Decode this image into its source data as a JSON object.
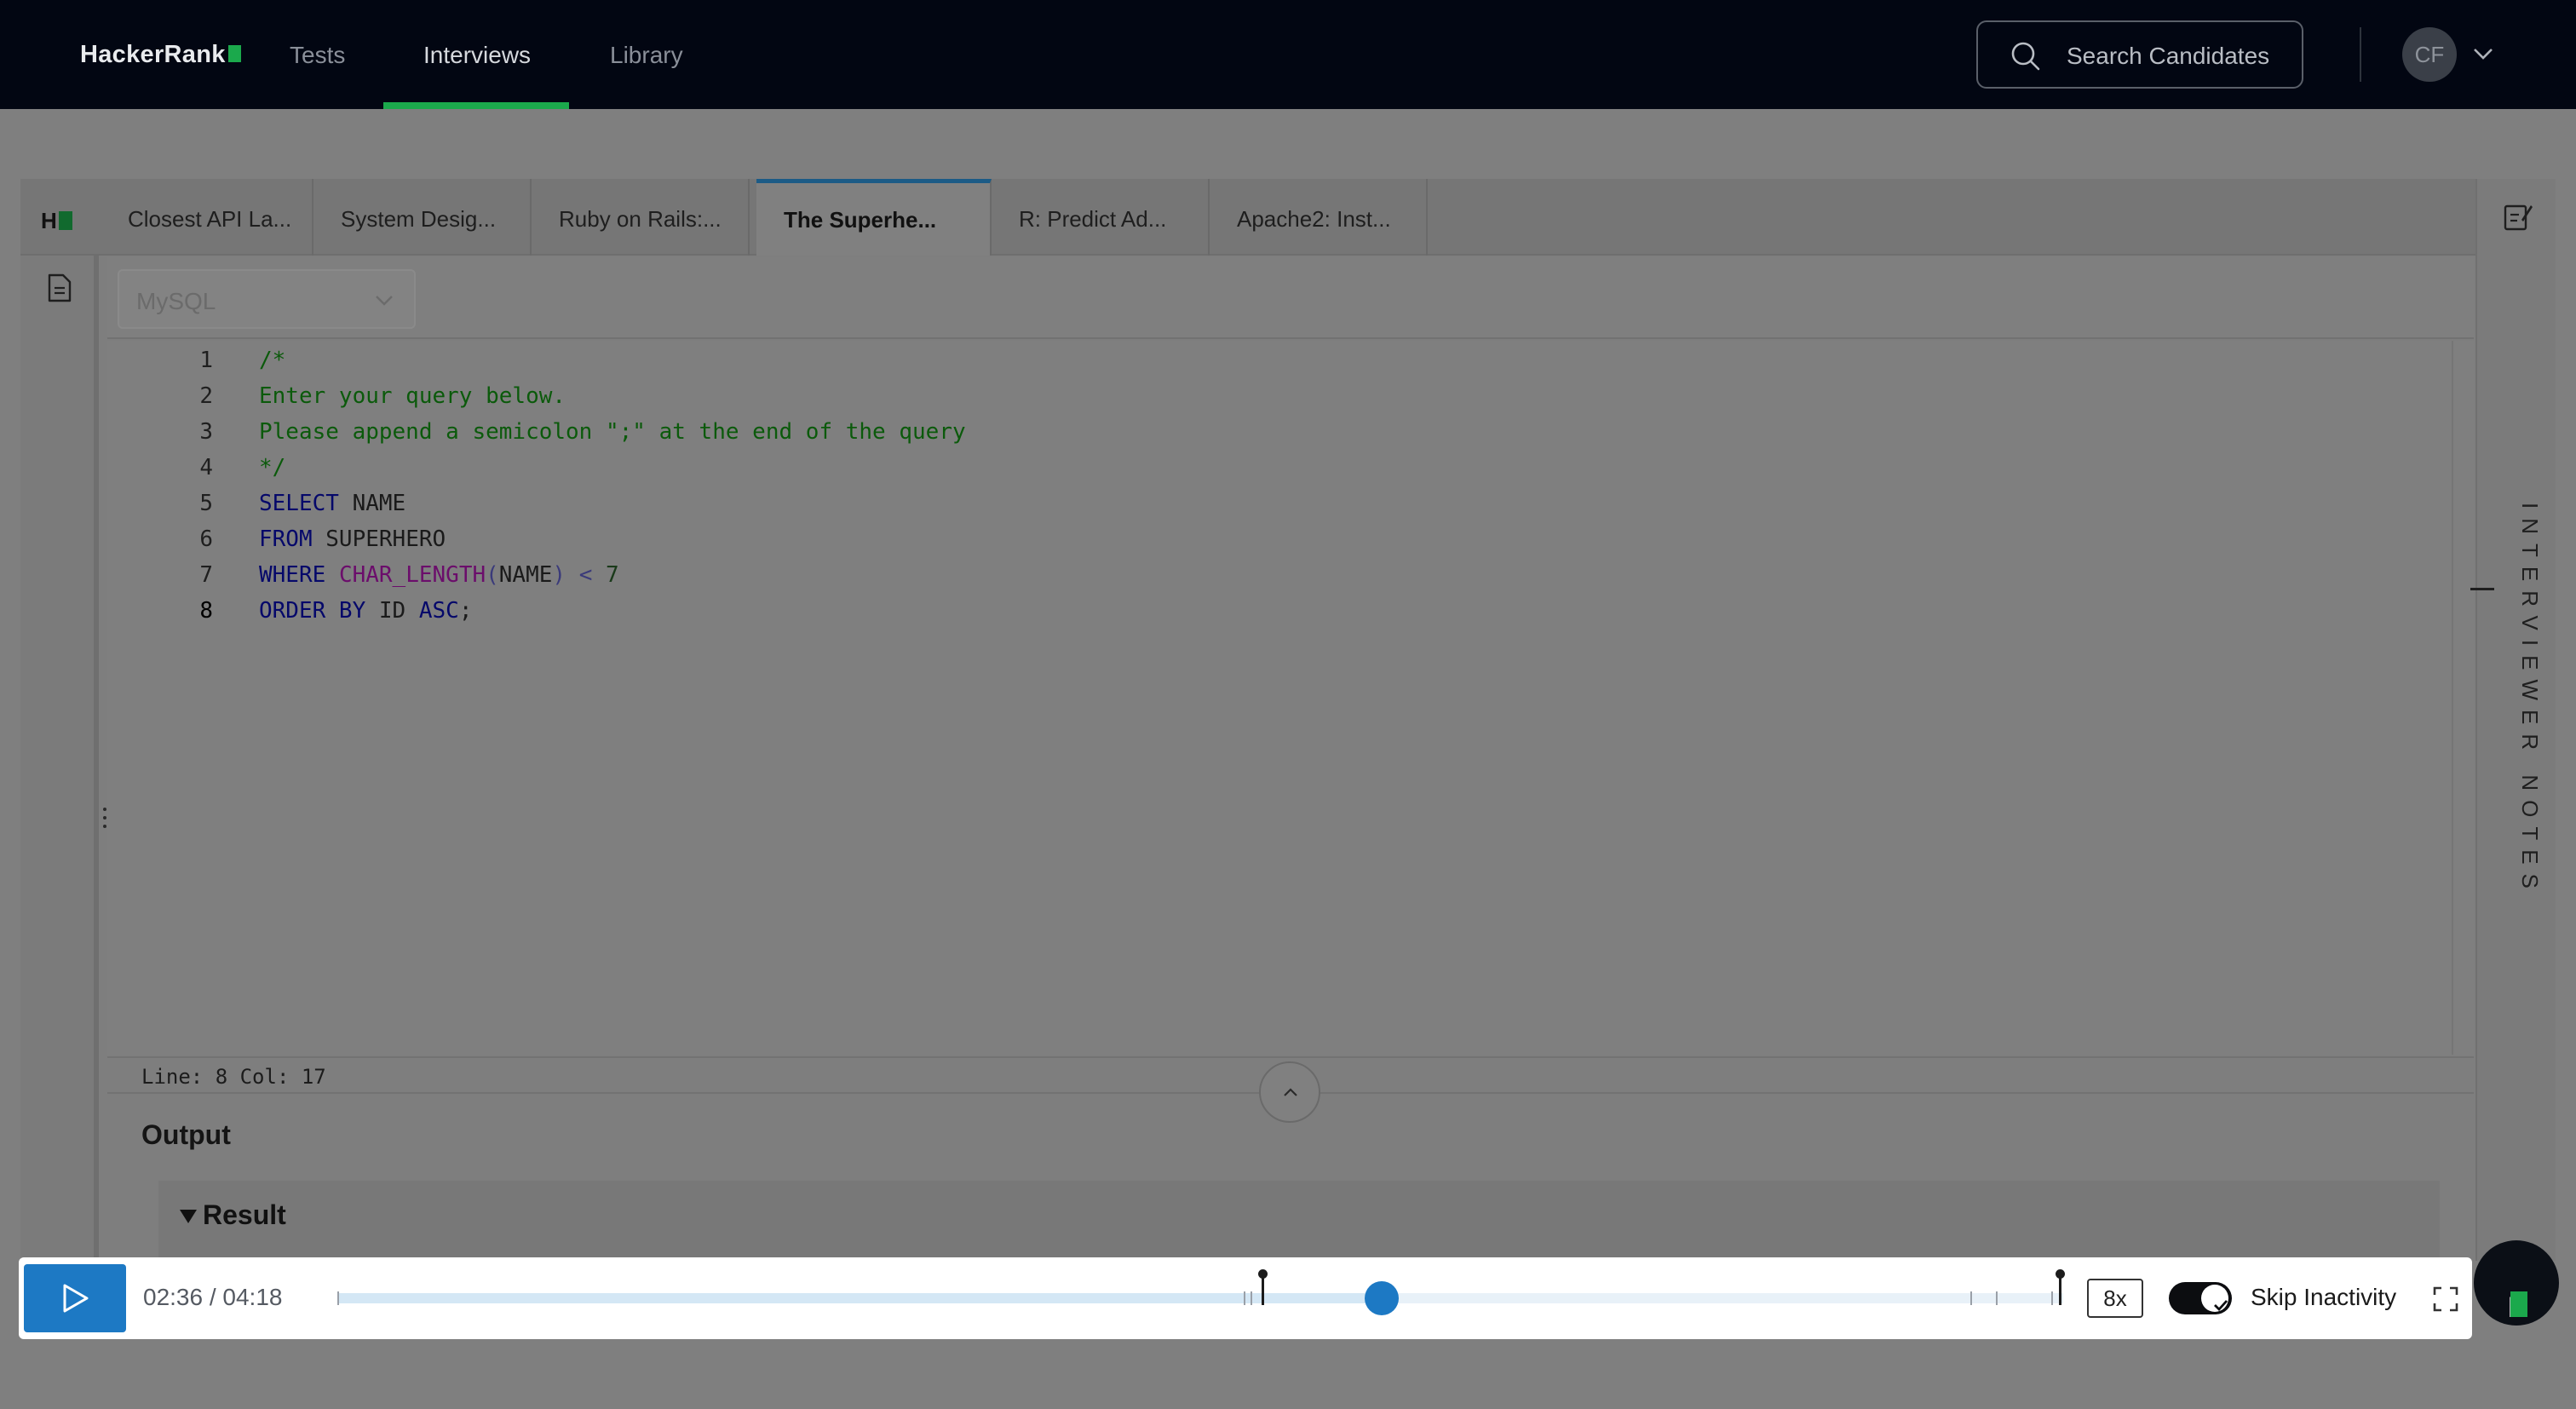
{
  "nav": {
    "logo_text": "HackerRank",
    "items": [
      {
        "label": "Tests"
      },
      {
        "label": "Interviews"
      },
      {
        "label": "Library"
      }
    ],
    "active_index": 1,
    "search_placeholder": "Search Candidates",
    "avatar_initials": "CF"
  },
  "workspace": {
    "brand_mark": "H",
    "tabs": [
      {
        "label": "Closest API La..."
      },
      {
        "label": "System Desig..."
      },
      {
        "label": "Ruby on Rails:..."
      },
      {
        "label": "The Superhe..."
      },
      {
        "label": "R: Predict Ad..."
      },
      {
        "label": "Apache2: Inst..."
      }
    ],
    "active_tab_index": 3,
    "language": "MySQL",
    "right_panel_label": "INTERVIEWER NOTES"
  },
  "editor": {
    "lines": [
      {
        "num": "1",
        "tokens": [
          {
            "t": "/*",
            "c": "com"
          }
        ]
      },
      {
        "num": "2",
        "tokens": [
          {
            "t": "Enter your query below.",
            "c": "com"
          }
        ]
      },
      {
        "num": "3",
        "tokens": [
          {
            "t": "Please append a semicolon \";\" at the end of the query",
            "c": "com"
          }
        ]
      },
      {
        "num": "4",
        "tokens": [
          {
            "t": "*/",
            "c": "com"
          }
        ]
      },
      {
        "num": "5",
        "tokens": [
          {
            "t": "SELECT",
            "c": "kw"
          },
          {
            "t": " NAME",
            "c": "id"
          }
        ]
      },
      {
        "num": "6",
        "tokens": [
          {
            "t": "FROM",
            "c": "kw"
          },
          {
            "t": " SUPERHERO",
            "c": "id"
          }
        ]
      },
      {
        "num": "7",
        "tokens": [
          {
            "t": "WHERE",
            "c": "kw"
          },
          {
            "t": " ",
            "c": "id"
          },
          {
            "t": "CHAR_LENGTH",
            "c": "fn"
          },
          {
            "t": "(",
            "c": "op"
          },
          {
            "t": "NAME",
            "c": "id"
          },
          {
            "t": ")",
            "c": "op"
          },
          {
            "t": " < ",
            "c": "op"
          },
          {
            "t": "7",
            "c": "num"
          }
        ]
      },
      {
        "num": "8",
        "tokens": [
          {
            "t": "ORDER BY",
            "c": "kw"
          },
          {
            "t": " ID ",
            "c": "id"
          },
          {
            "t": "ASC",
            "c": "kw"
          },
          {
            "t": ";",
            "c": "id"
          }
        ]
      }
    ],
    "current_line": "8",
    "status": "Line: 8 Col: 17"
  },
  "output": {
    "title": "Output",
    "result_label": "Result"
  },
  "player": {
    "time": "02:36 / 04:18",
    "progress": 0.605,
    "speed": "8x",
    "skip_inactivity_label": "Skip Inactivity",
    "skip_inactivity_on": true,
    "bookmark_fractions": [
      0.536,
      0.998
    ],
    "activity_tick_fractions": [
      0.0,
      0.525,
      0.529,
      0.946,
      0.961,
      0.993
    ]
  },
  "colors": {
    "nav_bg": "#020612",
    "accent_green": "#1ba94c",
    "accent_blue": "#1d79c4"
  }
}
